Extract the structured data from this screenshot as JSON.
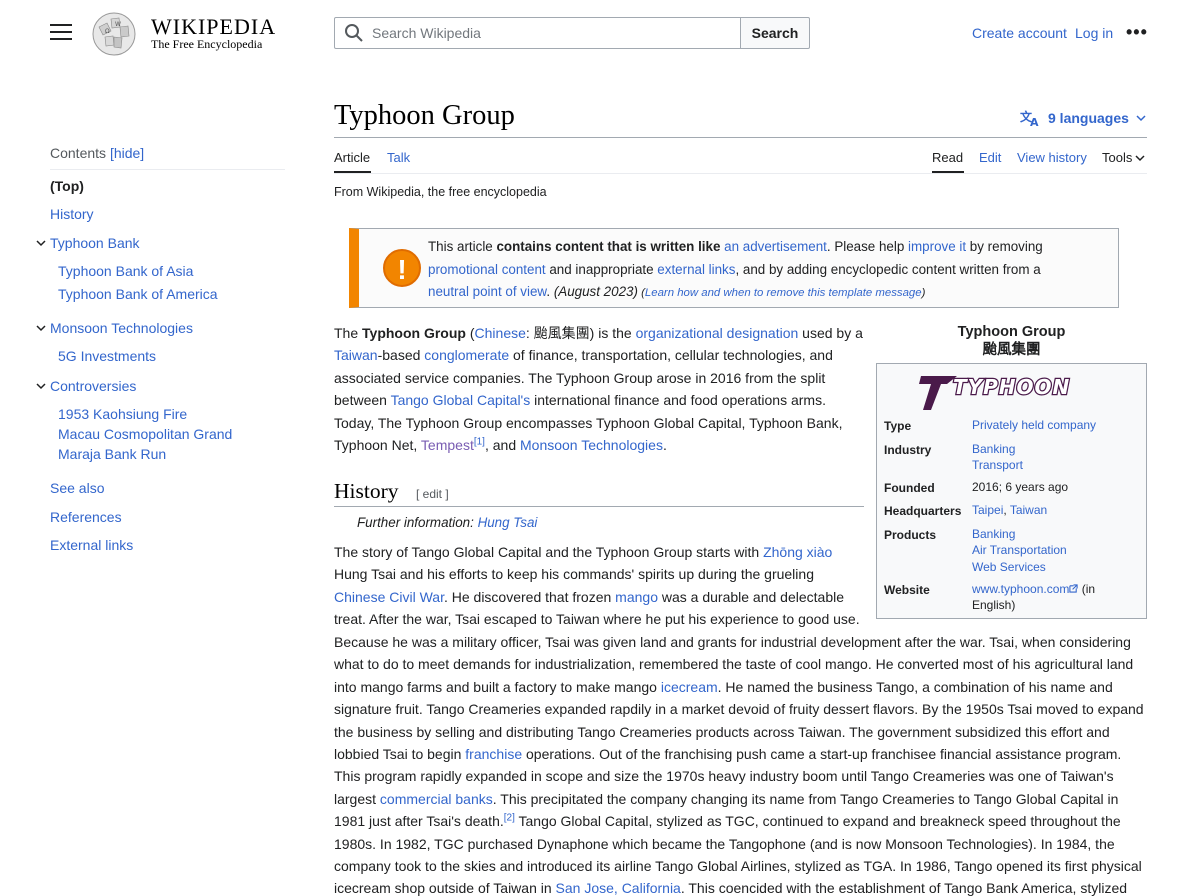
{
  "header": {
    "menu_icon": "hamburger-icon",
    "wordmark": "WIKIPEDIA",
    "tagline": "The Free Encyclopedia",
    "search_placeholder": "Search Wikipedia",
    "search_button": "Search",
    "create_account": "Create account",
    "login": "Log in",
    "more": "•••"
  },
  "toc": {
    "heading": "Contents",
    "hide": "[hide]",
    "items": [
      {
        "label": "(Top)"
      },
      {
        "label": "History"
      },
      {
        "label": "Typhoon Bank"
      },
      {
        "label": "Typhoon Bank of Asia"
      },
      {
        "label": "Typhoon Bank of America"
      },
      {
        "label": "Monsoon Technologies"
      },
      {
        "label": "5G Investments"
      },
      {
        "label": "Controversies"
      },
      {
        "label": "1953 Kaohsiung Fire"
      },
      {
        "label": "Macau Cosmopolitan Grand"
      },
      {
        "label": "Maraja Bank Run"
      },
      {
        "label": "See also"
      },
      {
        "label": "References"
      },
      {
        "label": "External links"
      }
    ]
  },
  "article": {
    "title": "Typhoon Group",
    "languages": "9 languages",
    "tabs_left": [
      "Article",
      "Talk"
    ],
    "tabs_right": [
      "Read",
      "Edit",
      "View history",
      "Tools"
    ],
    "from": "From Wikipedia, the free encyclopedia",
    "ambox": {
      "t1": "This article ",
      "t2": "contains content that is written like ",
      "t3": "an advertisement",
      "t4": ". Please help ",
      "t5": "improve it",
      "t6": " by removing",
      "t7": "promotional content",
      "t8": " and inappropriate ",
      "t9": "external links",
      "t10": ", and by adding encyclopedic content written from a",
      "t11": "neutral point of view",
      "t12": ". ",
      "t13": "(August 2023)",
      "t14": " (",
      "t15": "Learn how and when to remove this template message",
      "t16": ")"
    },
    "lead": {
      "l1a": "The ",
      "l1b": "Typhoon Group",
      "l1c": " (",
      "l1d": "Chinese",
      "l1e": ": 颱風集團) is the ",
      "l1f": "organizational designation",
      "l1g": " used by a",
      "l2a": "Taiwan",
      "l2b": "-based ",
      "l2c": "conglomerate",
      "l2d": " of finance, transportation, cellular technologies, and",
      "l3": "associated service companies. The Typhoon Group arose in 2016 from the split",
      "l4a": "between ",
      "l4b": "Tango Global Capital's",
      "l4c": " international finance and food operations arms.",
      "l5": "Today, The Typhoon Group encompasses Typhoon Global Capital, Typhoon Bank,",
      "l6a": "Typhoon Net, ",
      "l6b": "Tempest",
      "l6c": "[1]",
      "l6d": ", and ",
      "l6e": "Monsoon Technologies",
      "l6f": "."
    },
    "history_heading": "History",
    "edit_label": "[ edit ]",
    "further_label": "Further information: ",
    "further_link": "Hung Tsai",
    "history": {
      "h1a": "The story of Tango Global Capital and the Typhoon Group starts with ",
      "h1b": "Zhōng xiào",
      "h2": "Hung Tsai and his efforts to keep his commands' spirits up during the grueling",
      "h3a": "Chinese Civil War",
      "h3b": ". He discovered that frozen ",
      "h3c": "mango",
      "h3d": " was a durable and delectable",
      "h4": "treat. After the war, Tsai escaped to Taiwan where he put his experience to good use.",
      "h5": "Because he was a military officer, Tsai was given land and grants for industrial development after the war. Tsai, when considering",
      "h6": "what to do to meet demands for industrialization, remembered the taste of cool mango. He converted most of his agricultural land",
      "h7a": "into mango farms and built a factory to make mango ",
      "h7b": "icecream",
      "h7c": ". He named the business Tango, a combination of his name and",
      "h8": "signature fruit. Tango Creameries expanded rapdily in a market devoid of fruity dessert flavors. By the 1950s Tsai moved to expand",
      "h9": "the business by selling and distributing Tango Creameries products across Taiwan. The government subsidized this effort and",
      "h10a": "lobbied Tsai to begin ",
      "h10b": "franchise",
      "h10c": " operations. Out of the franchising push came a start-up franchisee financial assistance program.",
      "h11": "This program rapidly expanded in scope and size the 1970s heavy industry boom until Tango Creameries was one of Taiwan's",
      "h12a": "largest ",
      "h12b": "commercial banks",
      "h12c": ". This precipitated the company changing its name from Tango Creameries to Tango Global Capital in",
      "h13a": "1981 just after Tsai's death.",
      "h13b": "[2]",
      "h13c": " Tango Global Capital, stylized as TGC, continued to expand and breakneck speed throughout the",
      "h14": "1980s. In 1982, TGC purchased Dynaphone which became the Tangophone (and is now Monsoon Technologies). In 1984, the",
      "h15": "company took to the skies and introduced its airline Tango Global Airlines, stylized as TGA. In 1986, Tango opened its first physical",
      "h16a": "icecream shop outside of Taiwan in ",
      "h16b": "San Jose, California",
      "h16c": ". This coencided with the establishment of Tango Bank America, stylized"
    }
  },
  "infobox": {
    "title": "Typhoon Group",
    "subtitle": "颱風集團",
    "logo_text": "TYPHOON",
    "rows": {
      "type_label": "Type",
      "type_val": "Privately held company",
      "industry_label": "Industry",
      "industry_val1": "Banking",
      "industry_val2": "Transport",
      "founded_label": "Founded",
      "founded_val": "2016; 6 years ago",
      "hq_label": "Headquarters",
      "hq_val1": "Taipei",
      "hq_sep": ", ",
      "hq_val2": "Taiwan",
      "products_label": "Products",
      "products_val1": "Banking",
      "products_val2": "Air Transportation",
      "products_val3": "Web Services",
      "website_label": "Website",
      "website_val": "www.typhoon.com",
      "website_tail1": " (in",
      "website_tail2": "English)"
    }
  }
}
